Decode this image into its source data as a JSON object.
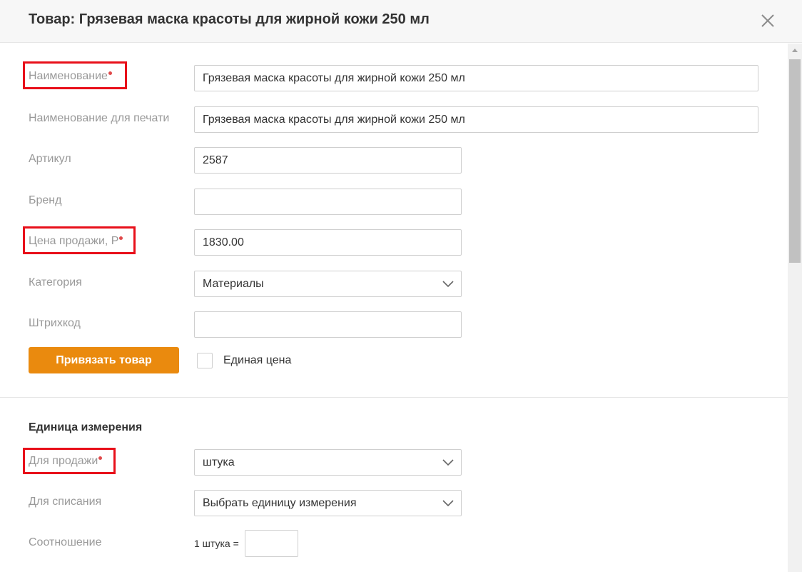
{
  "header": {
    "title": "Товар: Грязевая маска красоты для жирной кожи 250 мл",
    "close_icon": "close-icon"
  },
  "form": {
    "name": {
      "label": "Наименование",
      "value": "Грязевая маска красоты для жирной кожи 250 мл"
    },
    "print_name": {
      "label": "Наименование для печати",
      "value": "Грязевая маска красоты для жирной кожи 250 мл"
    },
    "article": {
      "label": "Артикул",
      "value": "2587"
    },
    "brand": {
      "label": "Бренд",
      "value": ""
    },
    "price": {
      "label": "Цена продажи, Р",
      "value": "1830.00"
    },
    "category": {
      "label": "Категория",
      "value": "Материалы"
    },
    "barcode": {
      "label": "Штрихкод",
      "value": ""
    },
    "bind_button": "Привязать товар",
    "single_price": {
      "label": "Единая цена",
      "checked": false
    }
  },
  "units": {
    "title": "Единица измерения",
    "for_sale": {
      "label": "Для продажи",
      "value": "штука"
    },
    "for_writeoff": {
      "label": "Для списания",
      "value": "Выбрать единицу измерения"
    },
    "ratio": {
      "label": "Соотношение",
      "prefix": "1 штука =",
      "value": ""
    }
  },
  "colors": {
    "accent": "#ea8a0e",
    "required_dot": "#e0494a",
    "highlight": "#e8101a"
  }
}
